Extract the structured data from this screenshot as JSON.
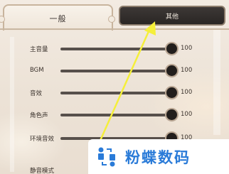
{
  "tabs": {
    "general": "一般",
    "other": "其他"
  },
  "settings": [
    {
      "label": "主音量",
      "value": "100",
      "level": 1.0
    },
    {
      "label": "BGM",
      "value": "100",
      "level": 1.0
    },
    {
      "label": "音效",
      "value": "100",
      "level": 1.0
    },
    {
      "label": "角色声",
      "value": "100",
      "level": 1.0
    },
    {
      "label": "环境音效",
      "value": "100",
      "level": 1.0
    }
  ],
  "mute_mode_label": "静音模式",
  "watermark": {
    "text": "粉蝶数码",
    "color": "#2a7bd8"
  },
  "colors": {
    "arrow": "#f5ef3a",
    "tab_active_bg": "#2a2624",
    "slider_track": "#57504b",
    "slider_knob": "#221e1c"
  }
}
